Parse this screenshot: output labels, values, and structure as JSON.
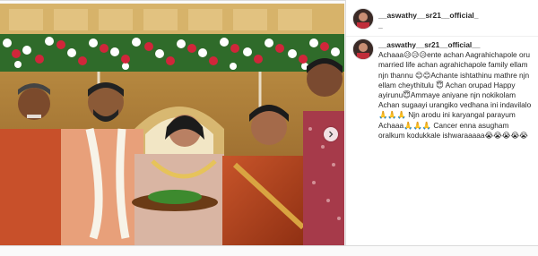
{
  "post": {
    "username_header": "__aswathy__sr21__official__",
    "username_comment": "__aswathy__sr21__official__",
    "caption": "Achaaa😥😥😥ente achan Aagrahichapole oru married life achan agrahichapole family ellam njn thannu 😊😊Achante ishtathinu mathre njn ellam cheythitulu 😇 Achan orupad Happy ayirunu😇Ammaye aniyane njn nokikolam Achan sugaayi urangiko vedhana ini indavilalo 🙏🙏🙏 Njn arodu ini karyangal parayum Achaaa🙏🙏🙏 Cancer enna asugham oralkum kodukkale ishwaraaaaa😭😭😭😭😭"
  },
  "icons": {
    "next": "chevron-right-icon"
  },
  "colors": {
    "text": "#262626",
    "border": "#dbdbdb",
    "photo_background": "#5a3b1c",
    "sari": "#b3441e",
    "gown": "#d9b5a3"
  }
}
